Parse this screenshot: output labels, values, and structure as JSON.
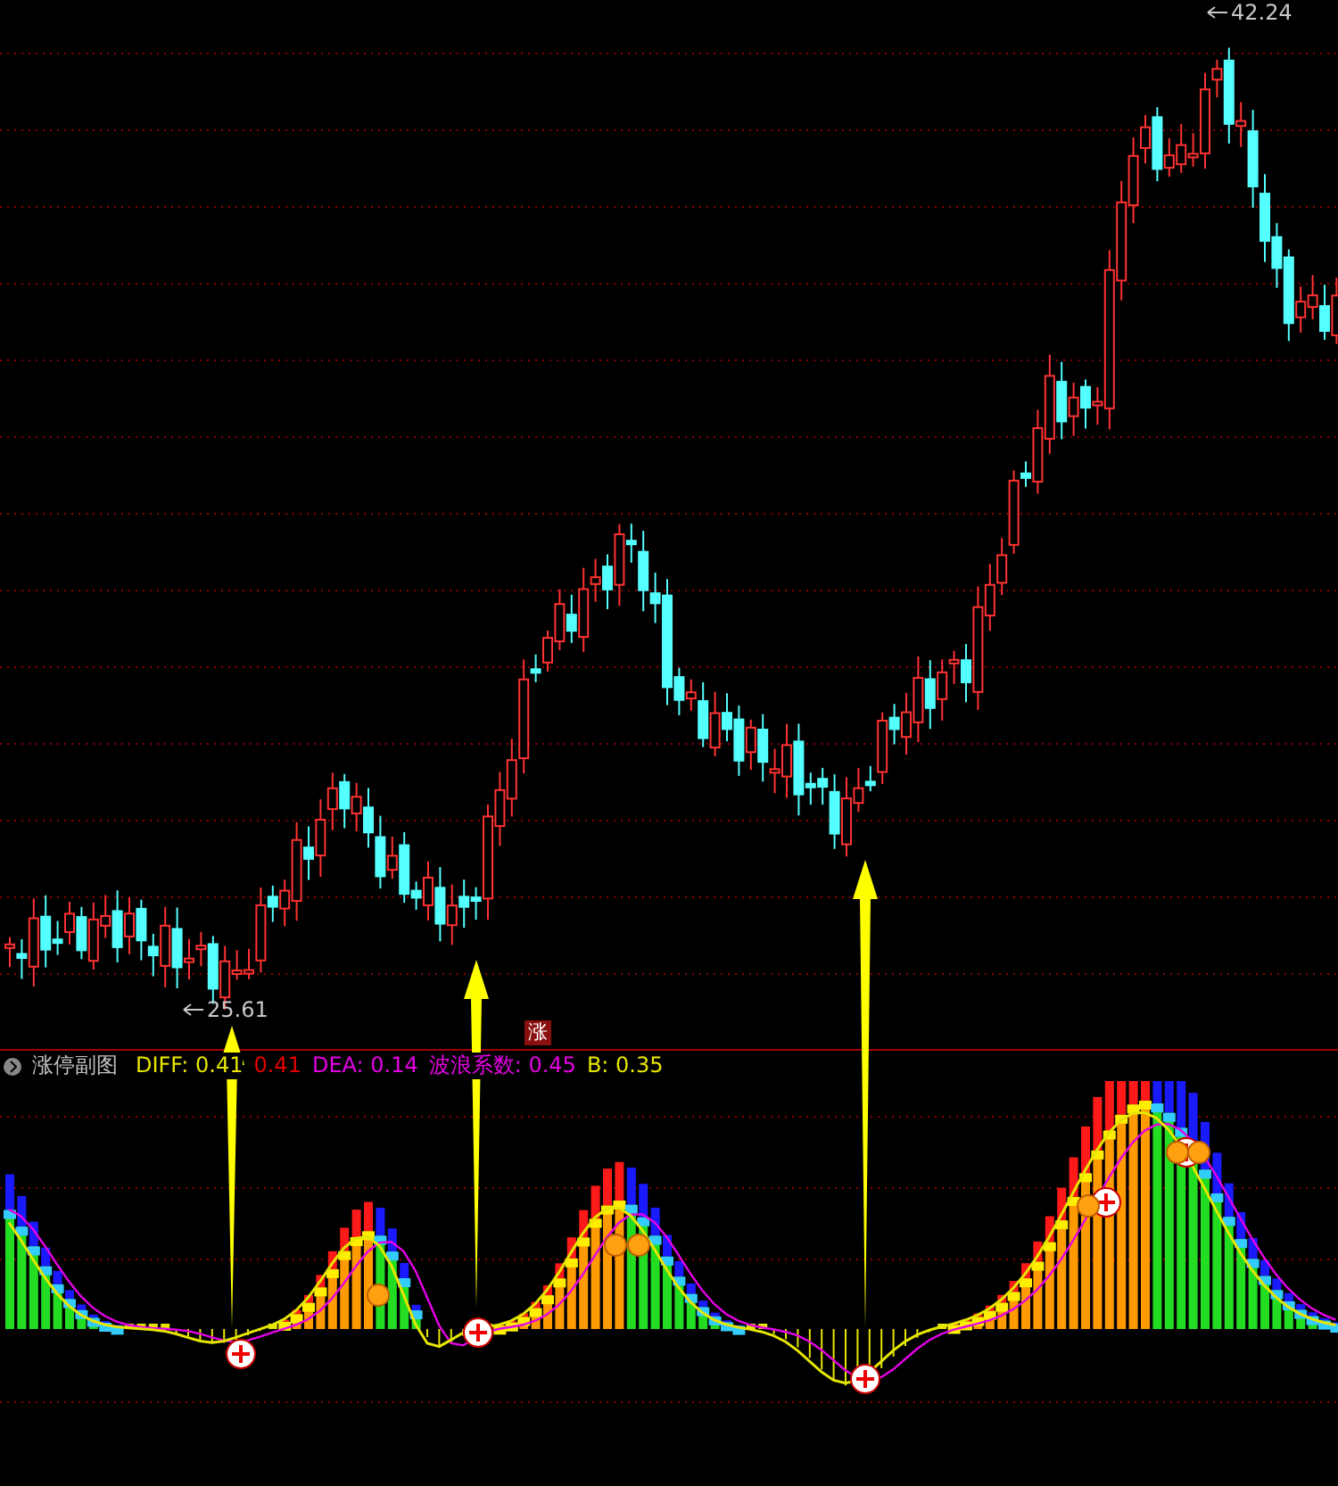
{
  "main_chart": {
    "high_label": "42.24",
    "low_label": "25.61",
    "marker": "涨"
  },
  "sub_chart": {
    "title": "涨停副图",
    "indicators": [
      {
        "label": "DIFF: 0.41",
        "color": "#e6e600"
      },
      {
        "label": "0.41",
        "color": "#e60000"
      },
      {
        "label": "DEA: 0.14",
        "color": "#e600e6"
      },
      {
        "label": "波浪系数: 0.45",
        "color": "#e600e6"
      },
      {
        "label": "B: 0.35",
        "color": "#e6e600"
      }
    ]
  }
}
